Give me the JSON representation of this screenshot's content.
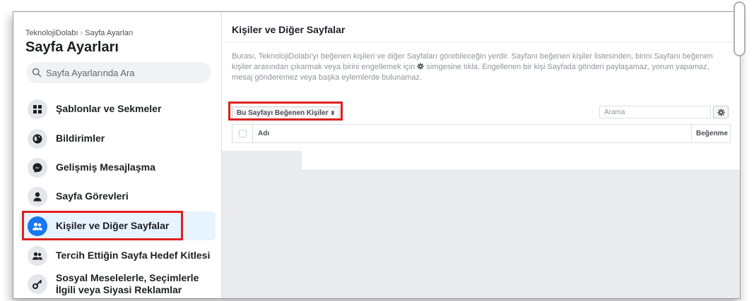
{
  "sidebar": {
    "breadcrumb": {
      "parent": "TeknolojiDolabı",
      "separator": "›",
      "current": "Sayfa Ayarları"
    },
    "title": "Sayfa Ayarları",
    "search_placeholder": "Sayfa Ayarlarında Ara",
    "items": [
      {
        "label": "Şablonlar ve Sekmeler",
        "icon": "grid-icon"
      },
      {
        "label": "Bildirimler",
        "icon": "globe-icon"
      },
      {
        "label": "Gelişmiş Mesajlaşma",
        "icon": "messenger-icon"
      },
      {
        "label": "Sayfa Görevleri",
        "icon": "person-icon"
      },
      {
        "label": "Kişiler ve Diğer Sayfalar",
        "icon": "people-icon",
        "active": true
      },
      {
        "label": "Tercih Ettiğin Sayfa Hedef Kitlesi",
        "icon": "people-icon"
      },
      {
        "label": "Sosyal Meselelerle, Seçimlerle İlgili veya Siyasi Reklamlar",
        "icon": "key-icon"
      }
    ]
  },
  "main": {
    "title": "Kişiler ve Diğer Sayfalar",
    "description_part1": "Burası, TeknolojiDolabı'yı beğenen kişileri ve diğer Sayfaları görebileceğin yerdir. Sayfanı beğenen kişiler listesinden, birini Sayfanı beğenen kişiler arasından çıkarmak veya birini engellemek için",
    "description_part2": "simgesine tıkla. Engellenen bir kişi Sayfada gönderi paylaşamaz, yorum yapamaz, mesaj gönderemez veya başka eylemlerde bulunamaz.",
    "filter_label": "Bu Sayfayı Beğenen Kişiler",
    "filter_caret": "⬍",
    "table_search_placeholder": "Arama",
    "columns": {
      "name": "Adı",
      "like": "Beğenme"
    }
  },
  "colors": {
    "accent": "#1877f2",
    "highlight": "#e02020",
    "active_bg": "#e7f3ff"
  }
}
